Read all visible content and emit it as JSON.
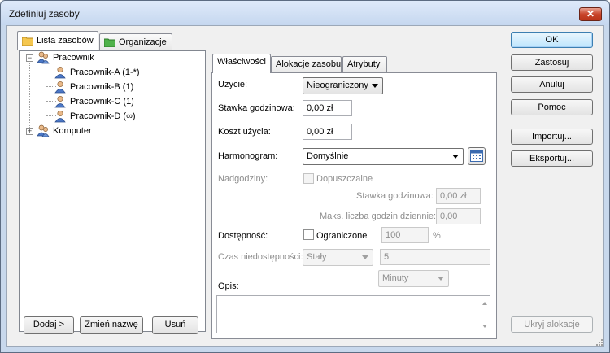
{
  "window": {
    "title": "Zdefiniuj zasoby",
    "close_glyph": "✕"
  },
  "left_tabs": [
    {
      "label": "Lista zasobów",
      "icon": "folder-icon"
    },
    {
      "label": "Organizacje",
      "icon": "green-folder-icon"
    }
  ],
  "tree": {
    "groups": [
      {
        "label": "Pracownik",
        "expander": "−",
        "children": [
          "Pracownik-A (1-*)",
          "Pracownik-B (1)",
          "Pracownik-C (1)",
          "Pracownik-D (∞)"
        ]
      },
      {
        "label": "Komputer",
        "expander": "+"
      }
    ]
  },
  "left_buttons": {
    "add": "Dodaj >",
    "rename": "Zmień nazwę",
    "remove": "Usuń"
  },
  "right_tabs": [
    "Właściwości",
    "Alokacje zasobu",
    "Atrybuty"
  ],
  "form": {
    "usage_label": "Użycie:",
    "usage_value": "Nieograniczony",
    "rate_label": "Stawka godzinowa:",
    "rate_value": "0,00 zł",
    "cost_label": "Koszt użycia:",
    "cost_value": "0,00 zł",
    "schedule_label": "Harmonogram:",
    "schedule_value": "Domyślnie",
    "overtime_label": "Nadgodziny:",
    "overtime_check": "Dopuszczalne",
    "ot_rate_label": "Stawka godzinowa:",
    "ot_rate_value": "0,00 zł",
    "ot_max_label": "Maks. liczba godzin dziennie:",
    "ot_max_value": "0,00",
    "availability_label": "Dostępność:",
    "availability_check": "Ograniczone",
    "availability_value": "100",
    "percent": "%",
    "unavail_label": "Czas niedostępności:",
    "unavail_type": "Stały",
    "unavail_value": "5",
    "unavail_unit": "Minuty",
    "desc_label": "Opis:"
  },
  "side_buttons": {
    "ok": "OK",
    "apply": "Zastosuj",
    "cancel": "Anuluj",
    "help": "Pomoc",
    "import": "Importuj...",
    "export": "Eksportuj...",
    "hide_alloc": "Ukryj alokacje"
  },
  "colors": {
    "accent": "#3c7fb1",
    "close": "#c9452a",
    "disabled_text": "#8d8d8d"
  }
}
